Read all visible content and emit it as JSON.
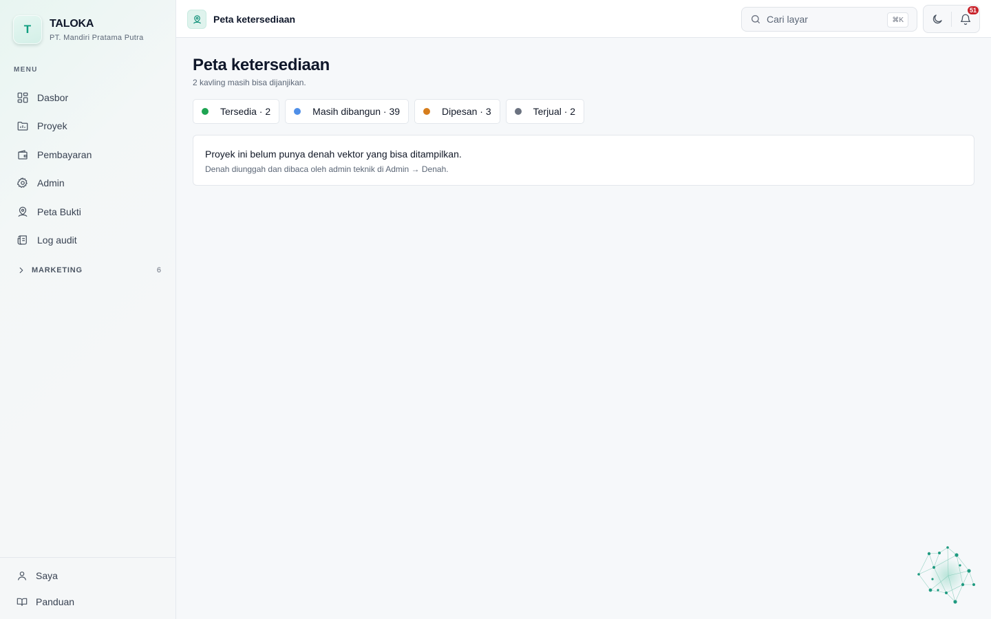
{
  "brand": {
    "logo_letter": "T",
    "name": "TALOKA",
    "company": "PT. Mandiri Pratama Putra"
  },
  "sidebar": {
    "menu_heading": "MENU",
    "items": [
      {
        "label": "Dasbor",
        "icon": "dashboard-icon"
      },
      {
        "label": "Proyek",
        "icon": "folder-icon"
      },
      {
        "label": "Pembayaran",
        "icon": "wallet-icon"
      },
      {
        "label": "Admin",
        "icon": "gear-icon"
      },
      {
        "label": "Peta Bukti",
        "icon": "map-pin-user-icon"
      },
      {
        "label": "Log audit",
        "icon": "scroll-icon"
      }
    ],
    "group": {
      "label": "MARKETING",
      "count": "6"
    },
    "bottom": [
      {
        "label": "Saya",
        "icon": "user-icon"
      },
      {
        "label": "Panduan",
        "icon": "book-icon"
      }
    ]
  },
  "topbar": {
    "title": "Peta ketersediaan",
    "search_placeholder": "Cari layar",
    "shortcut": "⌘K",
    "notification_count": "51"
  },
  "main": {
    "title": "Peta ketersediaan",
    "subtitle": "2 kavling masih bisa dijanjikan.",
    "legend": [
      {
        "label": "Tersedia · 2",
        "color": "#1ea452"
      },
      {
        "label": "Masih dibangun · 39",
        "color": "#4f8fe8"
      },
      {
        "label": "Dipesan · 3",
        "color": "#d67d1c"
      },
      {
        "label": "Terjual · 2",
        "color": "#6b7280"
      }
    ],
    "notice": {
      "title": "Proyek ini belum punya denah vektor yang bisa ditampilkan.",
      "description": "Denah diunggah dan dibaca oleh admin teknik di Admin → Denah."
    }
  },
  "colors": {
    "accent": "#12917a",
    "badge": "#c8232c",
    "background": "#f6f8fa"
  }
}
